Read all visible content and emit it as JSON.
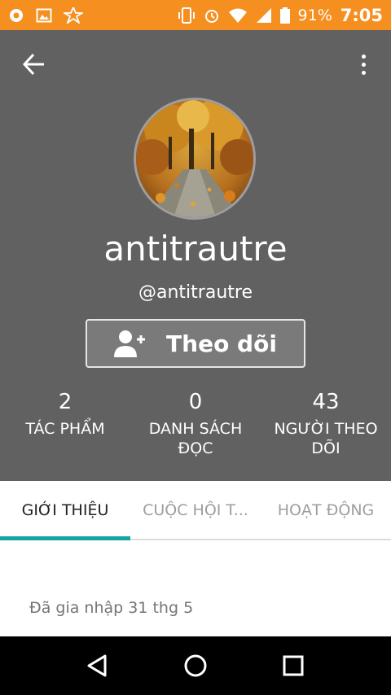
{
  "status_bar": {
    "battery": "91%",
    "time": "7:05",
    "color": "#f58f1f"
  },
  "profile": {
    "display_name": "antitrautre",
    "handle": "@antitrautre",
    "follow_label": "Theo dõi"
  },
  "stats": [
    {
      "value": "2",
      "label": "TÁC PHẨM"
    },
    {
      "value": "0",
      "label": "DANH SÁCH ĐỌC"
    },
    {
      "value": "43",
      "label": "NGƯỜI THEO DÕI"
    }
  ],
  "tabs": [
    {
      "label": "GIỚI THIỆU",
      "active": true
    },
    {
      "label": "CUỘC HỘI T...",
      "active": false
    },
    {
      "label": "HOẠT ĐỘNG",
      "active": false
    }
  ],
  "about": {
    "joined": "Đã gia nhập 31 thg 5"
  },
  "theme": {
    "header_bg": "#616161",
    "tab_indicator": "#16a3a3"
  }
}
